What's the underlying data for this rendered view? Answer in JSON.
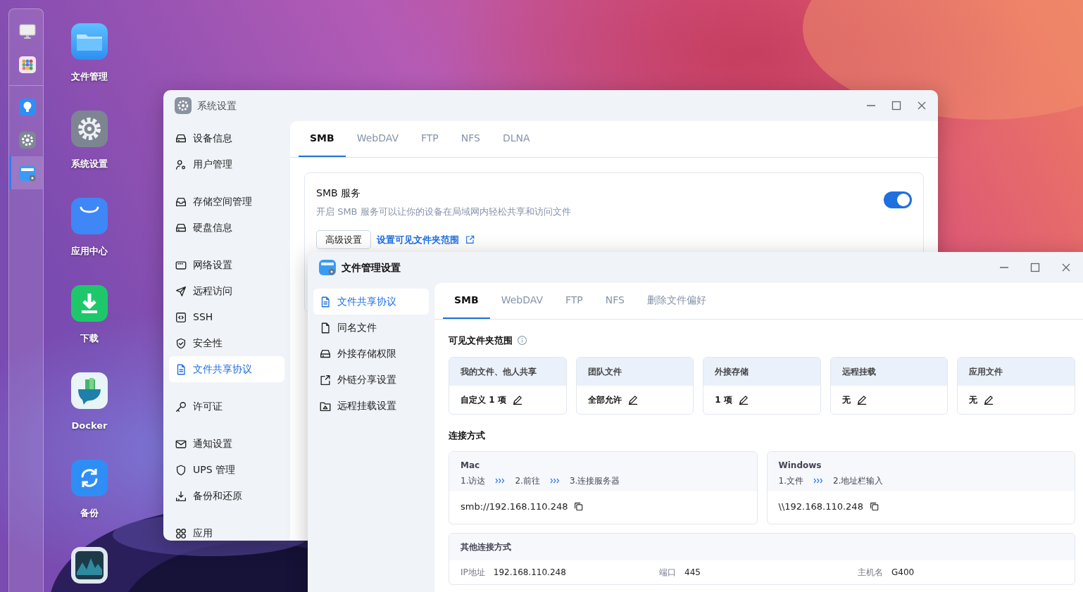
{
  "dock": {
    "items": [
      {
        "kind": "monitor",
        "selected": false
      },
      {
        "kind": "apps",
        "selected": false
      },
      {
        "kind": "bulb",
        "selected": false
      },
      {
        "kind": "gear",
        "selected": false
      },
      {
        "kind": "folder-gear",
        "selected": true
      }
    ]
  },
  "desktop_icons": [
    {
      "kind": "folder",
      "label": "文件管理"
    },
    {
      "kind": "gear",
      "label": "系统设置"
    },
    {
      "kind": "store",
      "label": "应用中心"
    },
    {
      "kind": "download",
      "label": "下载"
    },
    {
      "kind": "whale",
      "label": "Docker"
    },
    {
      "kind": "sync",
      "label": "备份"
    },
    {
      "kind": "chart"
    }
  ],
  "system_settings": {
    "title": "系统设置",
    "sidebar": {
      "groups": [
        {
          "items": [
            {
              "kind": "drive",
              "label": "设备信息",
              "selected": false
            },
            {
              "kind": "user",
              "label": "用户管理",
              "selected": false
            }
          ]
        },
        {
          "items": [
            {
              "kind": "inbox",
              "label": "存储空间管理",
              "selected": false
            },
            {
              "kind": "drive",
              "label": "硬盘信息",
              "selected": false
            }
          ]
        },
        {
          "items": [
            {
              "kind": "network",
              "label": "网络设置",
              "selected": false
            },
            {
              "kind": "send",
              "label": "远程访问",
              "selected": false
            },
            {
              "kind": "code",
              "label": "SSH",
              "selected": false
            },
            {
              "kind": "shield-check",
              "label": "安全性",
              "selected": false
            },
            {
              "kind": "doc",
              "label": "文件共享协议",
              "selected": true
            }
          ]
        },
        {
          "items": [
            {
              "kind": "key",
              "label": "许可证",
              "selected": false
            }
          ]
        },
        {
          "items": [
            {
              "kind": "mail",
              "label": "通知设置",
              "selected": false
            },
            {
              "kind": "shield",
              "label": "UPS 管理",
              "selected": false
            },
            {
              "kind": "download",
              "label": "备份和还原",
              "selected": false
            }
          ]
        },
        {
          "items": [
            {
              "kind": "apps",
              "label": "应用",
              "selected": false
            }
          ]
        }
      ]
    },
    "tabs": [
      {
        "label": "SMB",
        "selected": true
      },
      {
        "label": "WebDAV",
        "selected": false
      },
      {
        "label": "FTP",
        "selected": false
      },
      {
        "label": "NFS",
        "selected": false
      },
      {
        "label": "DLNA",
        "selected": false
      }
    ],
    "smb_service": {
      "title": "SMB 服务",
      "description": "开启 SMB 服务可以让你的设备在局域网内轻松共享和访问文件",
      "on": true,
      "button": "高级设置",
      "link": "设置可见文件夹范围"
    }
  },
  "file_manager_settings": {
    "title": "文件管理设置",
    "sidebar": {
      "items": [
        {
          "kind": "doc",
          "label": "文件共享协议",
          "selected": true
        },
        {
          "kind": "file",
          "label": "同名文件",
          "selected": false
        },
        {
          "kind": "drive",
          "label": "外接存储权限",
          "selected": false
        },
        {
          "kind": "share",
          "label": "外链分享设置",
          "selected": false
        },
        {
          "kind": "folder-cloud",
          "label": "远程挂载设置",
          "selected": false
        }
      ]
    },
    "tabs": [
      {
        "label": "SMB",
        "selected": true
      },
      {
        "label": "WebDAV",
        "selected": false
      },
      {
        "label": "FTP",
        "selected": false
      },
      {
        "label": "NFS",
        "selected": false
      },
      {
        "label": "删除文件偏好",
        "selected": false
      }
    ],
    "visible_scope": {
      "title": "可见文件夹范围",
      "cards": [
        {
          "header": "我的文件、他人共享",
          "value": "自定义 1 项"
        },
        {
          "header": "团队文件",
          "value": "全部允许"
        },
        {
          "header": "外接存储",
          "value": "1 项"
        },
        {
          "header": "远程挂载",
          "value": "无"
        },
        {
          "header": "应用文件",
          "value": "无"
        }
      ]
    },
    "connection": {
      "title": "连接方式",
      "methods": [
        {
          "name": "Mac",
          "steps": [
            "1.访达",
            "2.前往",
            "3.连接服务器"
          ],
          "address": "smb://192.168.110.248"
        },
        {
          "name": "Windows",
          "steps": [
            "1.文件",
            "2.地址栏输入"
          ],
          "address": "\\\\192.168.110.248"
        }
      ],
      "other": {
        "title": "其他连接方式",
        "fields": [
          {
            "label": "IP地址",
            "value": "192.168.110.248"
          },
          {
            "label": "端口",
            "value": "445"
          },
          {
            "label": "主机名",
            "value": "G400"
          }
        ]
      }
    }
  }
}
